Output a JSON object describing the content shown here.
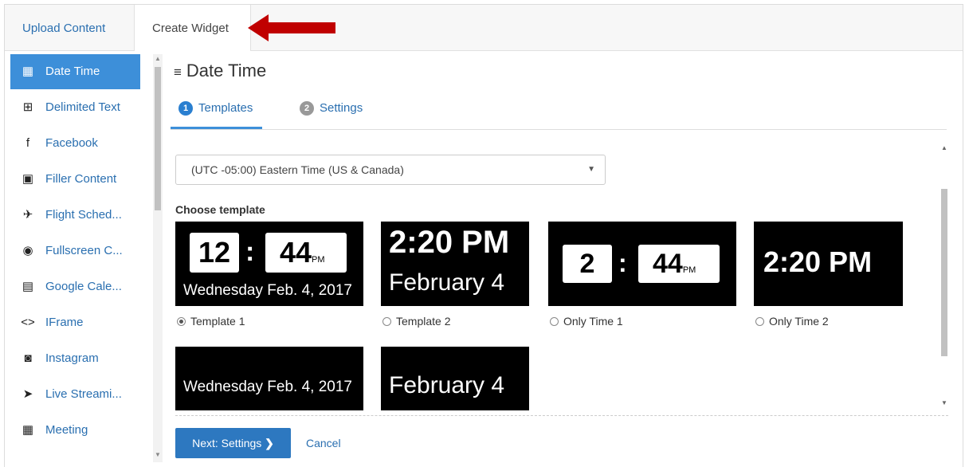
{
  "tabs": {
    "upload": "Upload Content",
    "create": "Create Widget"
  },
  "sidebar": {
    "items": [
      {
        "label": "Date Time",
        "icon": "calendar-clock-icon",
        "glyph": "▦",
        "active": true
      },
      {
        "label": "Delimited Text",
        "icon": "table-icon",
        "glyph": "⊞"
      },
      {
        "label": "Facebook",
        "icon": "facebook-icon",
        "glyph": "f"
      },
      {
        "label": "Filler Content",
        "icon": "image-icon",
        "glyph": "▣"
      },
      {
        "label": "Flight Sched...",
        "icon": "plane-icon",
        "glyph": "✈"
      },
      {
        "label": "Fullscreen C...",
        "icon": "fullscreen-icon",
        "glyph": "◉"
      },
      {
        "label": "Google Cale...",
        "icon": "calendar-icon",
        "glyph": "▤"
      },
      {
        "label": "IFrame",
        "icon": "code-icon",
        "glyph": "<>"
      },
      {
        "label": "Instagram",
        "icon": "instagram-icon",
        "glyph": "◙"
      },
      {
        "label": "Live Streami...",
        "icon": "stream-icon",
        "glyph": "➤"
      },
      {
        "label": "Meeting",
        "icon": "meeting-calendar-icon",
        "glyph": "▦"
      }
    ]
  },
  "main": {
    "title": "Date Time",
    "steps": [
      {
        "num": "1",
        "label": "Templates"
      },
      {
        "num": "2",
        "label": "Settings"
      }
    ],
    "timezone": "(UTC -05:00) Eastern Time (US & Canada)",
    "choose_label": "Choose template",
    "templates": [
      {
        "label": "Template 1",
        "selected": true,
        "hour": "12",
        "minute": "44",
        "ampm": "PM",
        "date": "Wednesday Feb. 4, 2017"
      },
      {
        "label": "Template 2",
        "selected": false,
        "time": "2:20 PM",
        "date": "February 4"
      },
      {
        "label": "Only Time 1",
        "selected": false,
        "hour": "2",
        "minute": "44",
        "ampm": "PM"
      },
      {
        "label": "Only Time 2",
        "selected": false,
        "time": "2:20 PM"
      },
      {
        "label": "",
        "date": "Wednesday Feb. 4, 2017"
      },
      {
        "label": "",
        "date": "February 4"
      }
    ],
    "next_button": "Next: Settings",
    "cancel_button": "Cancel"
  },
  "colors": {
    "accent": "#3d8fd9",
    "link": "#2a6fb0",
    "button": "#2d78c0",
    "arrow": "#c00000"
  }
}
